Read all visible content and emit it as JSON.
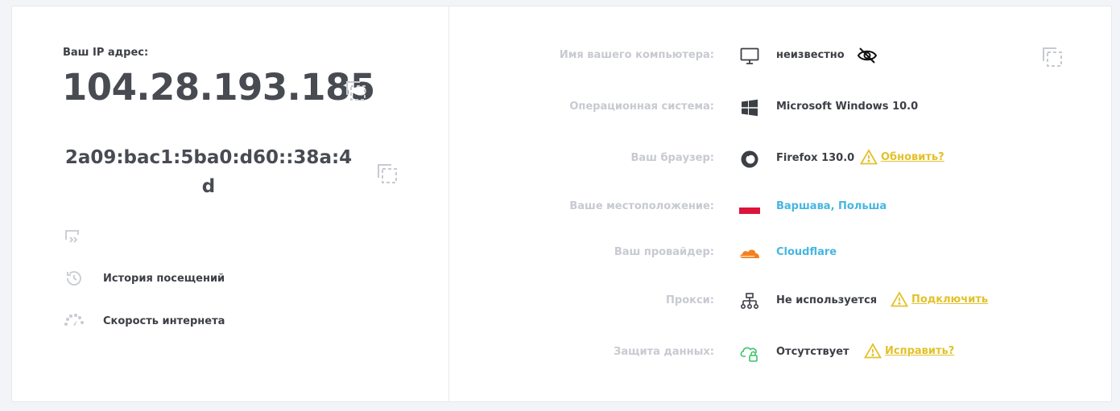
{
  "left": {
    "ip_label": "Ваш IP адрес:",
    "ipv4": "104.28.193.185",
    "ipv6": "2a09:bac1:5ba0:d60::38a:4d",
    "menu": [
      {
        "label": "История посещений",
        "icon": "history-icon"
      },
      {
        "label": "Скорость интернета",
        "icon": "speedometer-icon"
      }
    ]
  },
  "right": {
    "computer_name": {
      "label": "Имя вашего компьютера:",
      "value": "неизвестно"
    },
    "os": {
      "label": "Операционная система:",
      "value": "Microsoft Windows 10.0"
    },
    "browser": {
      "label": "Ваш браузер:",
      "value": "Firefox 130.0",
      "action": "Обновить?"
    },
    "location": {
      "label": "Ваше местоположение:",
      "value": "Варшава, Польша"
    },
    "provider": {
      "label": "Ваш провайдер:",
      "value": "Cloudflare"
    },
    "proxy": {
      "label": "Прокси:",
      "value": "Не используется",
      "action": "Подключить"
    },
    "protection": {
      "label": "Защита данных:",
      "value": "Отсутствует",
      "action": "Исправить?"
    }
  },
  "colors": {
    "link": "#46b6e0",
    "warning": "#e3c12a",
    "label_muted": "#c7cad0",
    "text": "#3c3f45",
    "flag_red": "#dc143c",
    "cloudflare_orange": "#f38020",
    "shield_green": "#3cc46a"
  }
}
